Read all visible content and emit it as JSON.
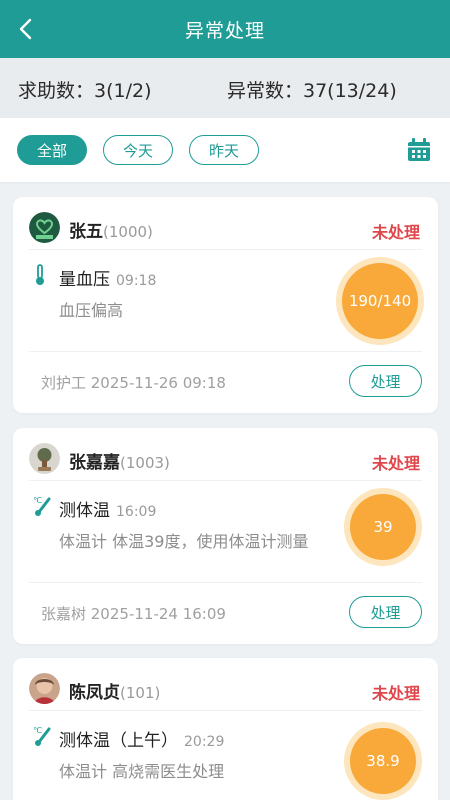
{
  "header": {
    "title": "异常处理",
    "back_icon": "chevron-left-icon"
  },
  "stats": {
    "help_text": "求助数：3(1/2)",
    "abnormal_text": "异常数：37(13/24)"
  },
  "filters": {
    "all": "全部",
    "today": "今天",
    "yesterday": "昨天",
    "calendar_icon": "calendar-icon"
  },
  "colors": {
    "primary": "#1f9c96",
    "alert": "#e0474c",
    "badge": "#f9a93a"
  },
  "records": [
    {
      "name": "张五",
      "id": "(1000)",
      "status": "未处理",
      "measure": "量血压",
      "time": "09:18",
      "desc": "血压偏高",
      "value": "190/140",
      "operator": "刘护工 2025-11-26 09:18",
      "action": "处理",
      "icon": "thermometer-icon"
    },
    {
      "name": "张嘉嘉",
      "id": "(1003)",
      "status": "未处理",
      "measure": "测体温",
      "time": "16:09",
      "desc": "体温计 体温39度，使用体温计测量",
      "value": "39",
      "operator": "张嘉树 2025-11-24 16:09",
      "action": "处理",
      "icon": "body-thermometer-icon"
    },
    {
      "name": "陈凤贞",
      "id": "(101)",
      "status": "未处理",
      "measure": "测体温（上午）",
      "time": "20:29",
      "desc": "体温计 高烧需医生处理",
      "value": "38.9",
      "icon": "body-thermometer-icon"
    }
  ]
}
